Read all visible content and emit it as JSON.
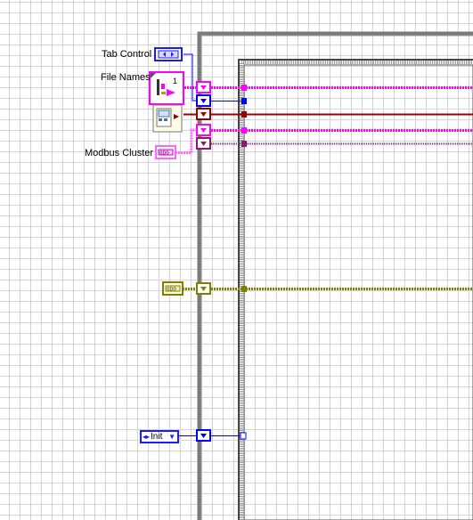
{
  "labels": {
    "tab_control": "Tab Control",
    "file_names": "File Names",
    "modbus_cluster": "Modbus Cluster"
  },
  "terminals": {
    "file_names_index": "1",
    "init_enum": "Init"
  },
  "colors": {
    "string_wire": "#ff00ff",
    "enum_wire": "#0000ff",
    "refnum_wire": "#990000",
    "cluster_wire": "#8b1a6b",
    "modbus_wire": "#ff66ff",
    "ref_cluster_wire": "#808000",
    "structure_gray": "#7a7a7a"
  },
  "icons": [
    "array-index-icon",
    "tab-enum-icon",
    "refnum-icon",
    "modbus-cluster-icon",
    "ref-cluster-icon",
    "shift-register-icon",
    "while-loop-frame",
    "case-structure-frame"
  ]
}
